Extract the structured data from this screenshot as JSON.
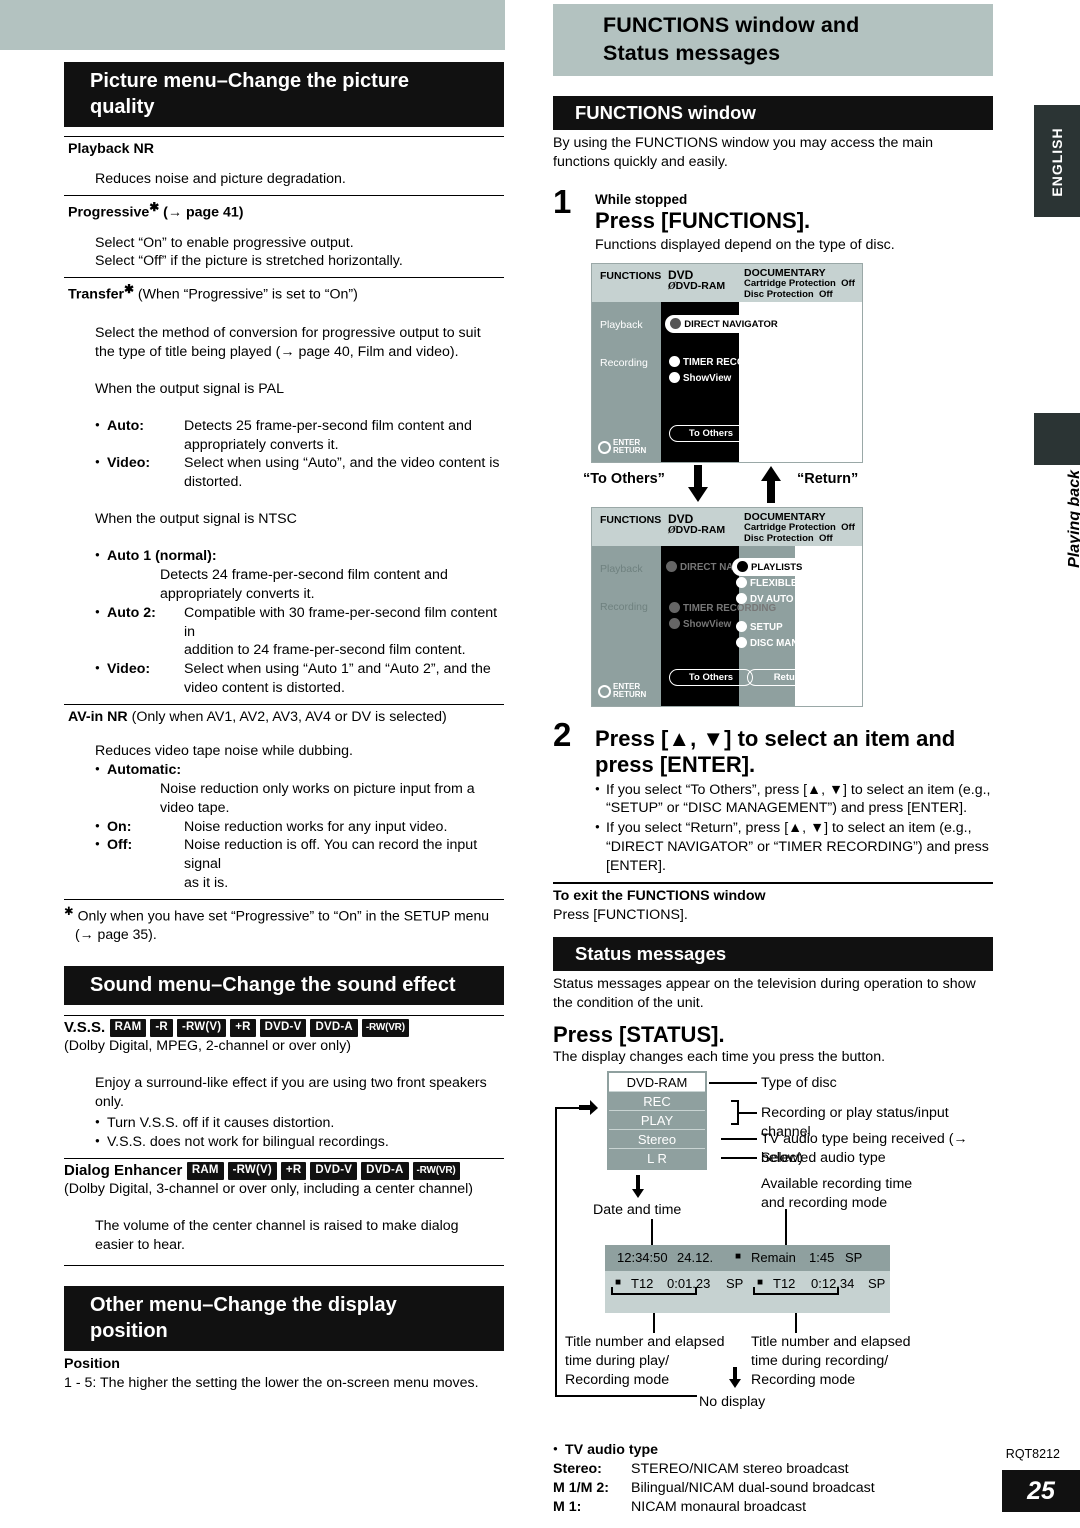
{
  "page": {
    "number": "25",
    "doc_code": "RQT8212"
  },
  "edge": {
    "english": "ENGLISH",
    "section": "Playing back"
  },
  "right_header": {
    "line1": "FUNCTIONS window and",
    "line2": "Status messages"
  },
  "picture_menu": {
    "header_line1": "Picture menu–Change the picture",
    "header_line2": "quality",
    "playback_nr": {
      "title": "Playback NR",
      "desc": "Reduces noise and picture degradation."
    },
    "progressive": {
      "title": "Progressive",
      "title_suffix": "(→ page 41)",
      "line1": "Select “On” to enable progressive output.",
      "line2": "Select “Off” if the picture is stretched horizontally."
    },
    "transfer": {
      "title": "Transfer",
      "title_suffix": "(When “Progressive” is set to “On”)",
      "desc1": "Select the method of conversion for progressive output to suit",
      "desc2": "the type of title being played (→ page 40, Film and video).",
      "pal_heading": "When the output signal is PAL",
      "pal_items": [
        {
          "term": "Auto:",
          "desc1": "Detects 25 frame-per-second film content and",
          "desc2": "appropriately converts it."
        },
        {
          "term": "Video:",
          "desc1": "Select when using “Auto”, and the video content is",
          "desc2": "distorted."
        }
      ],
      "ntsc_heading": "When the output signal is NTSC",
      "ntsc_items": [
        {
          "term": "Auto 1 (normal):",
          "stacked": true,
          "desc1": "Detects 24 frame-per-second film content and",
          "desc2": "appropriately converts it."
        },
        {
          "term": "Auto 2:",
          "stacked": false,
          "desc1": "Compatible with 30 frame-per-second film content in",
          "desc2": "addition to 24 frame-per-second film content."
        },
        {
          "term": "Video:",
          "stacked": false,
          "desc1": "Select when using “Auto 1” and “Auto 2”, and the",
          "desc2": "video content is distorted."
        }
      ]
    },
    "avin_nr": {
      "title": "AV-in NR",
      "title_suffix": "(Only when AV1, AV2, AV3, AV4 or DV is selected)",
      "desc": "Reduces video tape noise while dubbing.",
      "items": [
        {
          "term": "Automatic:",
          "stacked": true,
          "desc1": "Noise reduction only works on picture input from a",
          "desc2": "video tape."
        },
        {
          "term": "On:",
          "stacked": false,
          "desc1": "Noise reduction works for any input video.",
          "desc2": ""
        },
        {
          "term": "Off:",
          "stacked": false,
          "desc1": "Noise reduction is off. You can record the input signal",
          "desc2": "as it is."
        }
      ]
    },
    "footnote_line1": "Only when you have set “Progressive” to “On” in the SETUP menu",
    "footnote_line2": "(→ page 35)."
  },
  "sound_menu": {
    "header": "Sound menu–Change the sound effect",
    "vss": {
      "title": "V.S.S.",
      "badges": [
        "RAM",
        "-R",
        "-RW(V)",
        "+R",
        "DVD-V",
        "DVD-A",
        "-RW(VR)"
      ],
      "subtitle": "(Dolby Digital, MPEG, 2-channel or over only)",
      "desc1": "Enjoy a surround-like effect if you are using two front speakers",
      "desc2": "only.",
      "bullets": [
        "Turn V.S.S. off if it causes distortion.",
        "V.S.S. does not work for bilingual recordings."
      ]
    },
    "dialog_enhancer": {
      "title": "Dialog Enhancer",
      "badges": [
        "RAM",
        "-RW(V)",
        "+R",
        "DVD-V",
        "DVD-A",
        "-RW(VR)"
      ],
      "subtitle": "(Dolby Digital, 3-channel or over only, including a center channel)",
      "desc1": "The volume of the center channel is raised to make dialog",
      "desc2": "easier to hear."
    }
  },
  "other_menu": {
    "header_line1": "Other menu–Change the display",
    "header_line2": "position",
    "position_title": "Position",
    "position_desc": "1 - 5: The higher the setting the lower the on-screen menu moves."
  },
  "functions_window": {
    "header": "FUNCTIONS window",
    "intro1": "By using the FUNCTIONS window you may access the main",
    "intro2": "functions quickly and easily.",
    "step1": {
      "num": "1",
      "pre": "While stopped",
      "big": "Press [FUNCTIONS].",
      "sub": "Functions displayed depend on the type of disc."
    },
    "screen1": {
      "title": "FUNCTIONS",
      "disc_label": "DVD",
      "disc_type": "DVD-RAM",
      "disc_name": "DOCUMENTARY",
      "protect1_label": "Cartridge Protection",
      "protect1_value": "Off",
      "protect2_label": "Disc Protection",
      "protect2_value": "Off",
      "playback_label": "Playback",
      "recording_label": "Recording",
      "direct_navigator": "DIRECT NAVIGATOR",
      "timer_recording": "TIMER RECORDING",
      "showview": "ShowView",
      "to_others": "To Others",
      "enter": "ENTER",
      "return": "RETURN"
    },
    "transition": {
      "left": "“To Others”",
      "right": "“Return”"
    },
    "screen2": {
      "title": "FUNCTIONS",
      "disc_label": "DVD",
      "disc_type": "DVD-RAM",
      "disc_name": "DOCUMENTARY",
      "protect1_label": "Cartridge Protection",
      "protect1_value": "Off",
      "protect2_label": "Disc Protection",
      "protect2_value": "Off",
      "playback_label": "Playback",
      "recording_label": "Recording",
      "direct_navigator": "DIRECT NAVIGATOR",
      "timer_recording": "TIMER RECORDING",
      "showview": "ShowView",
      "playlists": "PLAYLISTS",
      "flexible_rec": "FLEXIBLE REC",
      "dv_auto_rec": "DV AUTO REC",
      "setup": "SETUP",
      "disc_management": "DISC MANAGEMENT",
      "to_others": "To Others",
      "return_btn": "Return",
      "enter": "ENTER",
      "return": "RETURN"
    },
    "step2": {
      "num": "2",
      "big1": "Press [▲, ▼] to select an item and",
      "big2": "press [ENTER].",
      "bullets": [
        "If you select “To Others”, press [▲, ▼] to select an item (e.g., “SETUP” or “DISC MANAGEMENT”) and press [ENTER].",
        "If you select “Return”, press [▲, ▼] to select an item (e.g., “DIRECT NAVIGATOR” or “TIMER RECORDING”) and press [ENTER]."
      ]
    },
    "exit_title": "To exit the FUNCTIONS window",
    "exit_desc": "Press [FUNCTIONS]."
  },
  "status_messages": {
    "header": "Status messages",
    "intro1": "Status messages appear on the television during operation to show",
    "intro2": "the condition of the unit.",
    "press": "Press [STATUS].",
    "press_sub": "The display changes each time you press the button.",
    "display": {
      "row_disc": "DVD-RAM",
      "row_rec": "REC",
      "row_play": "PLAY",
      "row_stereo": "Stereo",
      "row_lr": "L R"
    },
    "callouts": {
      "type_of_disc": "Type of disc",
      "rec_status": "Recording or play status/input channel",
      "tv_audio": "TV audio type being received (→ below)",
      "selected_audio": "Selected audio type",
      "avail_rec1": "Available recording time",
      "avail_rec2": "and recording mode",
      "date_time": "Date and time",
      "title_play1": "Title number and elapsed",
      "title_play2": "time during play/",
      "title_play3": "Recording mode",
      "title_rec1": "Title number and elapsed",
      "title_rec2": "time during recording/",
      "title_rec3": "Recording mode",
      "no_display": "No display"
    },
    "bar_top": {
      "time": "12:34:50",
      "date": "24.12.",
      "remain_label": "Remain",
      "remain_value": "1:45",
      "mode": "SP"
    },
    "bar_play": {
      "title": "T12",
      "elapsed": "0:01.23",
      "mode": "SP"
    },
    "bar_rec": {
      "title": "T12",
      "elapsed": "0:12.34",
      "mode": "SP"
    },
    "tv_audio_type": {
      "title": "TV audio type",
      "rows": [
        {
          "term": "Stereo:",
          "desc": "STEREO/NICAM stereo broadcast"
        },
        {
          "term": "M 1/M 2:",
          "desc": "Bilingual/NICAM dual-sound broadcast"
        },
        {
          "term": "M 1:",
          "desc": "NICAM monaural broadcast"
        }
      ]
    }
  }
}
